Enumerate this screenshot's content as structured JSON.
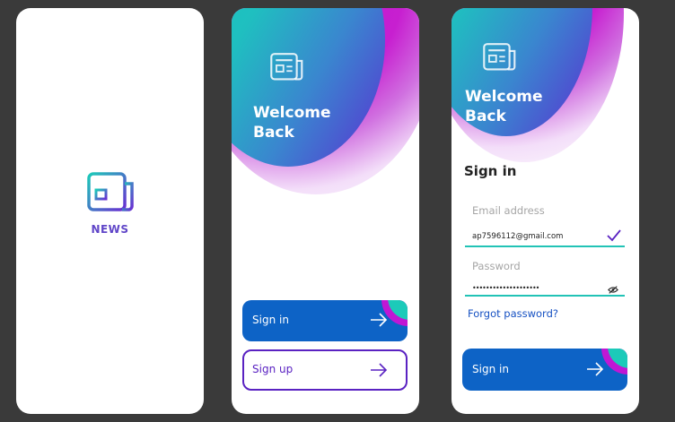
{
  "splash": {
    "title": "NEWS"
  },
  "welcome_screen": {
    "heading_line1": "Welcome",
    "heading_line2": "Back",
    "sign_in_button": "Sign in",
    "sign_up_button": "Sign up"
  },
  "signin_screen": {
    "heading_line1": "Welcome",
    "heading_line2": "Back",
    "section_title": "Sign in",
    "email_label": "Email address",
    "email_value": "ap7596112@gmail.com",
    "password_label": "Password",
    "password_value": "••••••••••••••••••••",
    "forgot_link": "Forgot password?",
    "submit_button": "Sign in"
  },
  "colors": {
    "teal": "#16cdb9",
    "purple": "#5a2fd2",
    "magenta": "#c017d4",
    "primary_blue": "#0d63c6",
    "outline_purple": "#5a22c2",
    "link_blue": "#1550c2"
  },
  "icons": {
    "logo": "newspaper-icon",
    "arrow": "arrow-right-icon",
    "valid": "checkmark-icon",
    "password_toggle": "eye-off-icon"
  }
}
